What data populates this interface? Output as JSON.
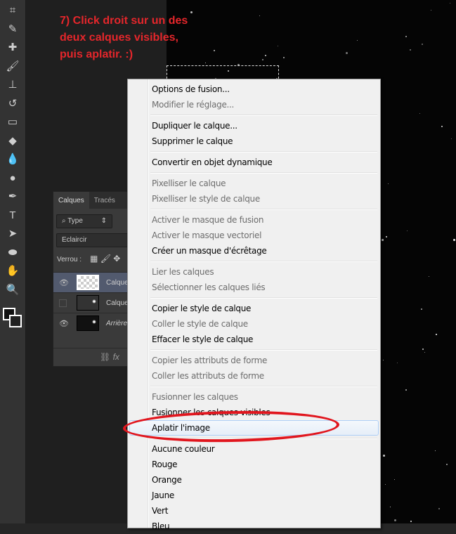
{
  "annotation": {
    "lines": [
      "7) Click droit sur un des",
      "deux calques visibles,",
      "puis aplatir. :)"
    ],
    "color": "#e5262b"
  },
  "toolbar": {
    "tools": [
      "crop-tool",
      "eyedropper-tool",
      "healing-brush-tool",
      "brush-tool",
      "clone-stamp-tool",
      "history-brush-tool",
      "eraser-tool",
      "paint-bucket-tool",
      "blur-tool",
      "dodge-tool",
      "pen-tool",
      "type-tool",
      "path-selection-tool",
      "ellipse-tool",
      "hand-tool",
      "zoom-tool"
    ]
  },
  "layers_panel": {
    "tabs": [
      "Calques",
      "Tracés"
    ],
    "filter": "Type",
    "blend_mode": "Eclaircir",
    "lock_label": "Verrou :",
    "layers": [
      {
        "name": "Calque",
        "visible": true,
        "selected": true
      },
      {
        "name": "Calque",
        "visible": false,
        "selected": false
      },
      {
        "name": "Arrière",
        "visible": true,
        "selected": false
      }
    ]
  },
  "context_menu": {
    "groups": [
      [
        {
          "label": "Options de fusion...",
          "enabled": true
        },
        {
          "label": "Modifier le réglage...",
          "enabled": false
        }
      ],
      [
        {
          "label": "Dupliquer le calque...",
          "enabled": true
        },
        {
          "label": "Supprimer le calque",
          "enabled": true
        }
      ],
      [
        {
          "label": "Convertir en objet dynamique",
          "enabled": true
        }
      ],
      [
        {
          "label": "Pixelliser le calque",
          "enabled": false
        },
        {
          "label": "Pixelliser le style de calque",
          "enabled": false
        }
      ],
      [
        {
          "label": "Activer le masque de fusion",
          "enabled": false
        },
        {
          "label": "Activer le masque vectoriel",
          "enabled": false
        },
        {
          "label": "Créer un masque d'écrêtage",
          "enabled": true
        }
      ],
      [
        {
          "label": "Lier les calques",
          "enabled": false
        },
        {
          "label": "Sélectionner les calques liés",
          "enabled": false
        }
      ],
      [
        {
          "label": "Copier le style de calque",
          "enabled": true
        },
        {
          "label": "Coller le style de calque",
          "enabled": false
        },
        {
          "label": "Effacer le style de calque",
          "enabled": true
        }
      ],
      [
        {
          "label": "Copier les attributs de forme",
          "enabled": false
        },
        {
          "label": "Coller les attributs de forme",
          "enabled": false
        }
      ],
      [
        {
          "label": "Fusionner les calques",
          "enabled": false
        },
        {
          "label": "Fusionner les calques visibles",
          "enabled": true
        },
        {
          "label": "Aplatir l'image",
          "enabled": true,
          "highlighted": true
        }
      ],
      [
        {
          "label": "Aucune couleur",
          "enabled": true
        },
        {
          "label": "Rouge",
          "enabled": true
        },
        {
          "label": "Orange",
          "enabled": true
        },
        {
          "label": "Jaune",
          "enabled": true
        },
        {
          "label": "Vert",
          "enabled": true
        },
        {
          "label": "Bleu",
          "enabled": true
        }
      ]
    ]
  }
}
